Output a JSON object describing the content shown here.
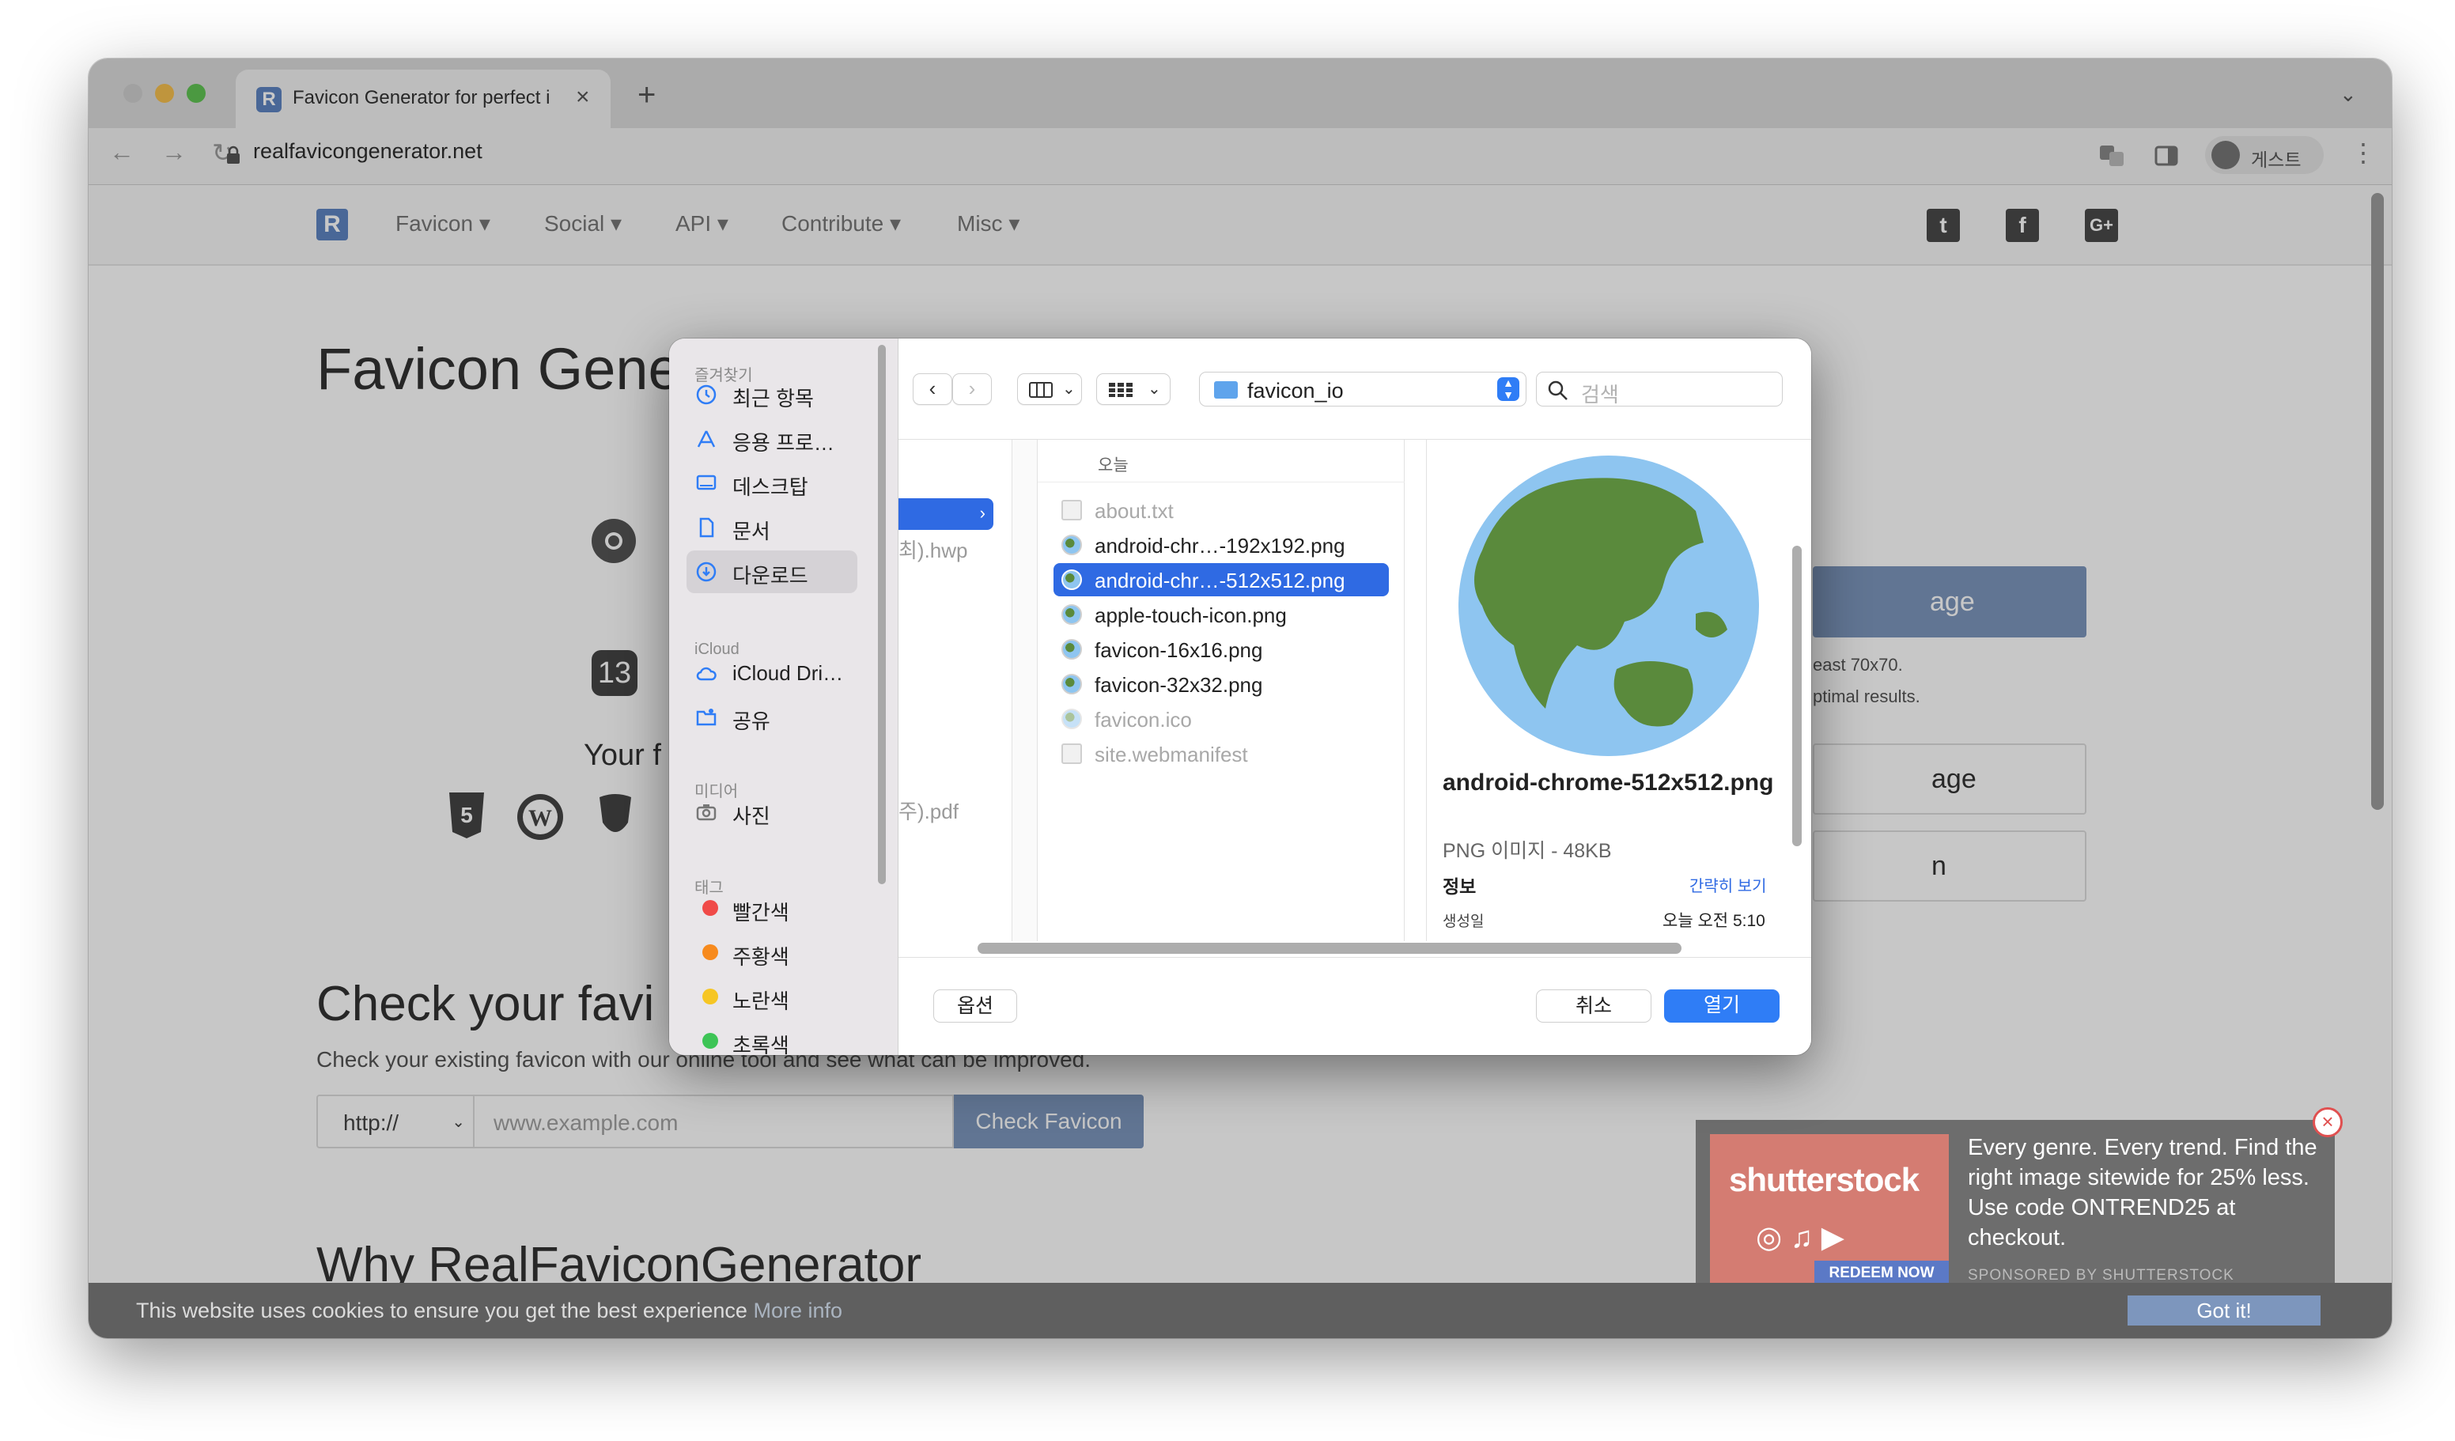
{
  "browser": {
    "tab": {
      "title": "Favicon Generator for perfect i"
    },
    "url": "realfavicongenerator.net",
    "profile": "게스트"
  },
  "page": {
    "nav": [
      "Favicon",
      "Social",
      "API",
      "Contribute",
      "Misc"
    ],
    "logo": "R",
    "h1_partial": "Favicon Gene",
    "ios_badge": "13",
    "your_f": "Your f",
    "select_btn_partial": "age",
    "size_hint_1": "east 70x70.",
    "size_hint_2": "ptimal results.",
    "btn2_partial": "age",
    "btn3_partial": "n",
    "check_h2": "Check your favi",
    "check_text": "Check your existing favicon with our online tool and see what can be improved.",
    "protocol": "http://",
    "domain_placeholder": "www.example.com",
    "check_button": "Check Favicon",
    "why_h2": "Why RealFaviconGenerator",
    "social": {
      "twitter": "t",
      "facebook": "f",
      "google": "G+"
    }
  },
  "ad": {
    "logo": "shutterstock",
    "redeem": "REDEEM NOW",
    "text": "Every genre. Every trend. Find the right image sitewide for 25% less. Use code ONTREND25 at checkout.",
    "sponsored": "SPONSORED BY SHUTTERSTOCK",
    "close": "×"
  },
  "cookie": {
    "text": "This website uses cookies to ensure you get the best experience ",
    "more": "More info",
    "button": "Got it!"
  },
  "dialog": {
    "sidebar": {
      "favorites_header": "즐겨찾기",
      "favorites": [
        {
          "label": "최근 항목",
          "icon": "clock-icon"
        },
        {
          "label": "응용 프로…",
          "icon": "apps-icon"
        },
        {
          "label": "데스크탑",
          "icon": "desktop-icon"
        },
        {
          "label": "문서",
          "icon": "document-icon"
        },
        {
          "label": "다운로드",
          "icon": "download-icon",
          "selected": true
        }
      ],
      "icloud_header": "iCloud",
      "icloud": [
        {
          "label": "iCloud Dri…",
          "icon": "cloud-icon"
        },
        {
          "label": "공유",
          "icon": "shared-folder-icon"
        }
      ],
      "media_header": "미디어",
      "media": [
        {
          "label": "사진",
          "icon": "camera-icon"
        }
      ],
      "tags_header": "태그",
      "tags": [
        {
          "label": "빨간색",
          "color": "#f04a48"
        },
        {
          "label": "주황색",
          "color": "#f78a1d"
        },
        {
          "label": "노란색",
          "color": "#f6c624"
        },
        {
          "label": "초록색",
          "color": "#3dc456"
        }
      ]
    },
    "folder": "favicon_io",
    "search_placeholder": "검색",
    "col1_items": [
      "최).hwp",
      "주).pdf"
    ],
    "col_header": "오늘",
    "files": [
      {
        "name": "about.txt",
        "dim": true,
        "selected": false
      },
      {
        "name": "android-chr…-192x192.png",
        "dim": false,
        "selected": false
      },
      {
        "name": "android-chr…-512x512.png",
        "dim": false,
        "selected": true
      },
      {
        "name": "apple-touch-icon.png",
        "dim": false,
        "selected": false
      },
      {
        "name": "favicon-16x16.png",
        "dim": false,
        "selected": false
      },
      {
        "name": "favicon-32x32.png",
        "dim": false,
        "selected": false
      },
      {
        "name": "favicon.ico",
        "dim": true,
        "selected": false
      },
      {
        "name": "site.webmanifest",
        "dim": true,
        "selected": false
      }
    ],
    "preview": {
      "name": "android-chrome-512x512.png",
      "meta": "PNG 이미지 - 48KB",
      "info": "정보",
      "less_link": "간략히 보기",
      "created_key": "생성일",
      "created_val": "오늘 오전 5:10"
    },
    "buttons": {
      "options": "옵션",
      "cancel": "취소",
      "open": "열기"
    }
  },
  "colors": {
    "accent": "#2f7df6",
    "selection": "#2f6ae3"
  }
}
